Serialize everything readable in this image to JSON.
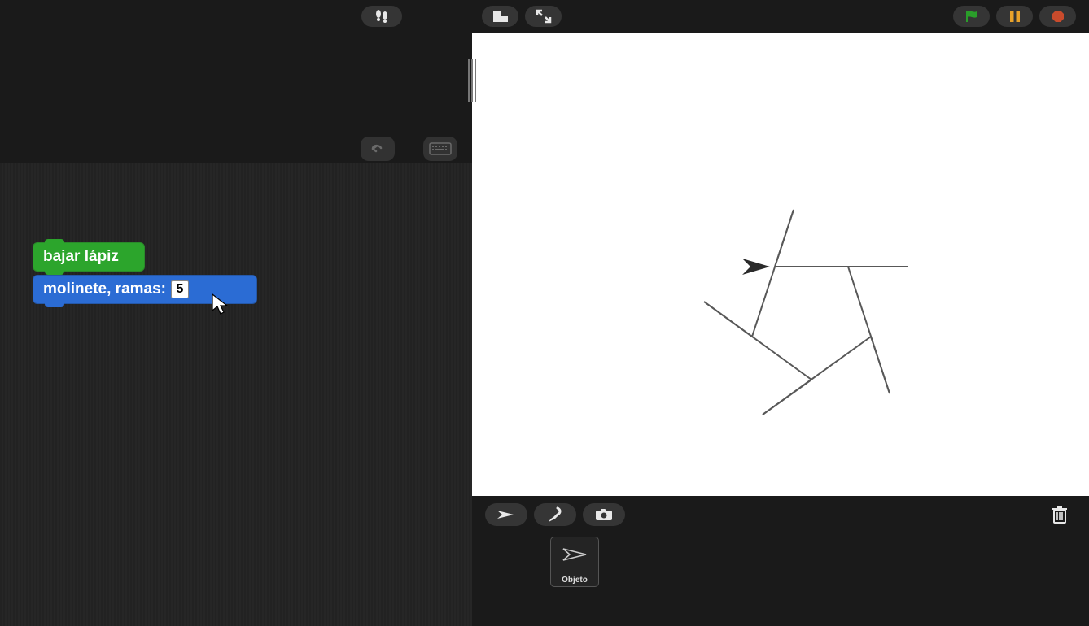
{
  "toolbar": {
    "footprints": "footprints",
    "stage_small": "stage-small",
    "fullscreen": "fullscreen",
    "flag": "green-flag",
    "pause": "pause",
    "stop": "stop"
  },
  "scripts": {
    "block_pen_down": "bajar lápiz",
    "block_molinete_label": "molinete, ramas:",
    "block_molinete_value": "5"
  },
  "stage": {
    "pinwheel_branches": 5
  },
  "sprite_bar": {
    "turtle_tab": "turtle",
    "paint": "paint",
    "camera": "camera",
    "trash": "trash"
  },
  "sprites": {
    "item1_label": "Objeto"
  }
}
